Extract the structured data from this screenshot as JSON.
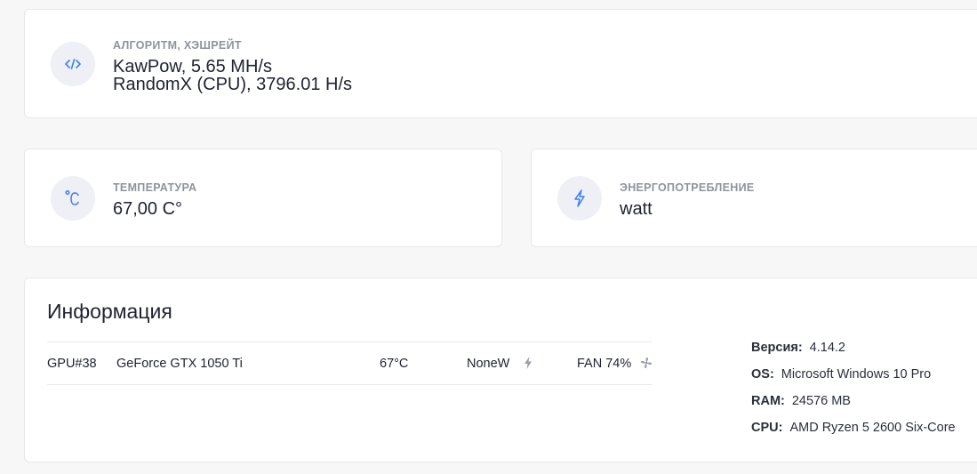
{
  "algo": {
    "label": "Алгоритм, хэшрейт",
    "line1": "KawPow, 5.65 MH/s",
    "line2": "RandomX (CPU), 3796.01 H/s",
    "icon": "code-icon"
  },
  "temperature": {
    "label": "Температура",
    "value": "67,00 C°",
    "icon": "celsius-icon"
  },
  "power": {
    "label": "Энергопотребление",
    "value": "watt",
    "icon": "lightning-icon"
  },
  "info": {
    "title": "Информация",
    "gpus": [
      {
        "id": "GPU#38",
        "name": "GeForce GTX 1050 Ti",
        "temp": "67°C",
        "power": "NoneW",
        "fan": "FAN 74%"
      }
    ],
    "system": [
      {
        "key": "Версия:",
        "value": "4.14.2"
      },
      {
        "key": "OS:",
        "value": "Microsoft Windows 10 Pro"
      },
      {
        "key": "RAM:",
        "value": "24576 MB"
      },
      {
        "key": "CPU:",
        "value": "AMD Ryzen 5 2600 Six-Core"
      }
    ]
  },
  "colors": {
    "accent": "#3d7ff0",
    "muted": "#8e939e",
    "background": "#f7f7f7",
    "card": "#ffffff"
  }
}
